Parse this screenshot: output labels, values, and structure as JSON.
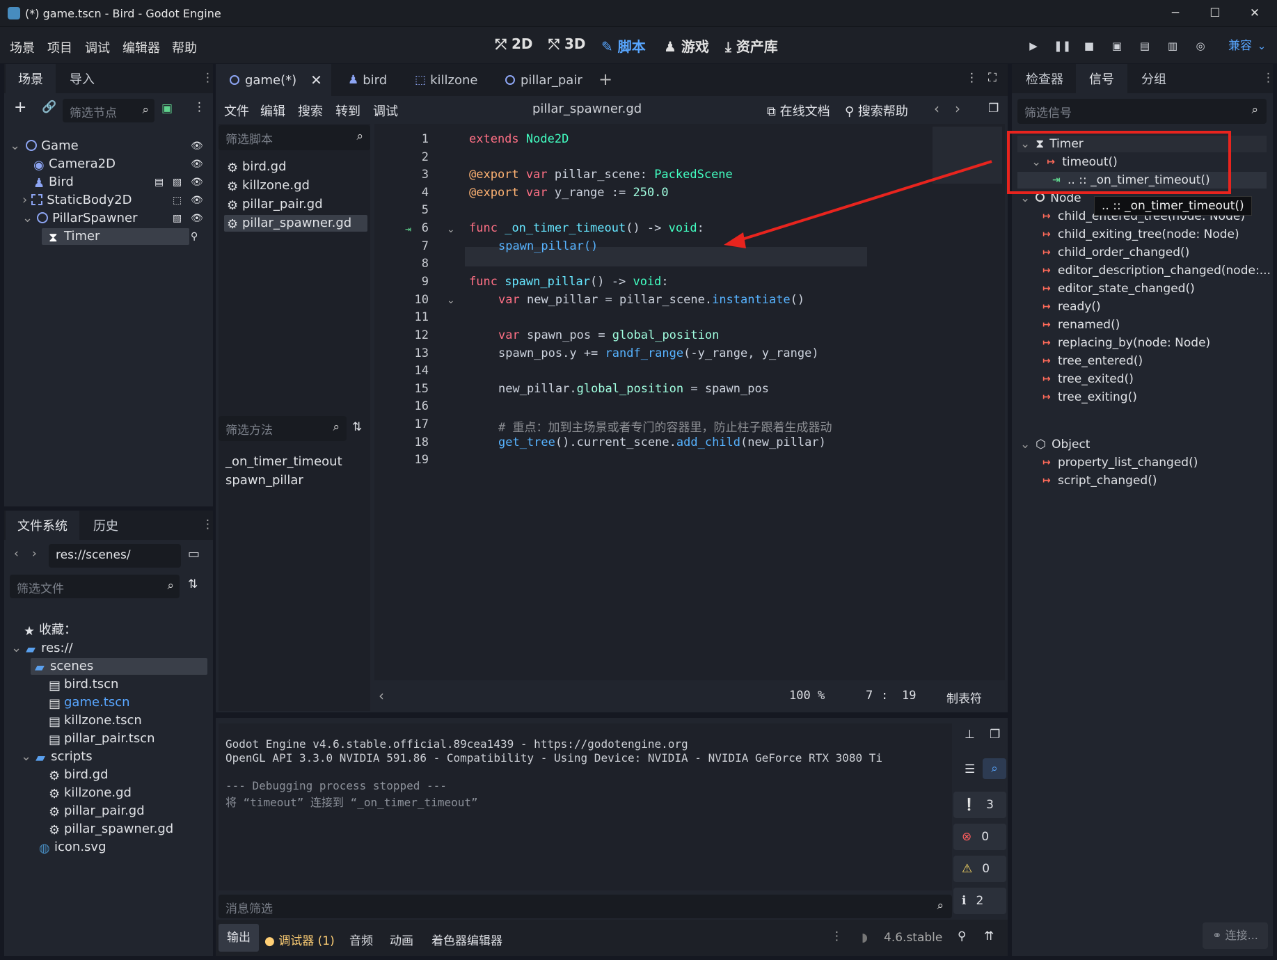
{
  "window": {
    "title": "(*) game.tscn - Bird - Godot Engine",
    "min": "─",
    "max": "☐",
    "close": "✕"
  },
  "menu": [
    "场景",
    "项目",
    "调试",
    "编辑器",
    "帮助"
  ],
  "workspaces": [
    {
      "label": "2D"
    },
    {
      "label": "3D"
    },
    {
      "label": "脚本"
    },
    {
      "label": "游戏"
    },
    {
      "label": "资产库"
    }
  ],
  "renderer": "兼容",
  "scene_dock": {
    "tabs": [
      "场景",
      "导入"
    ],
    "filter_placeholder": "筛选节点",
    "nodes": [
      {
        "name": "Game",
        "arrow": "⌄"
      },
      {
        "name": "Camera2D"
      },
      {
        "name": "Bird"
      },
      {
        "name": "StaticBody2D",
        "arrow": "›"
      },
      {
        "name": "PillarSpawner",
        "arrow": "⌄"
      },
      {
        "name": "Timer"
      }
    ]
  },
  "fs_dock": {
    "tabs": [
      "文件系统",
      "历史"
    ],
    "path": "res://scenes/",
    "filter_placeholder": "筛选文件",
    "favorites": "收藏：",
    "items": [
      {
        "label": "res://"
      },
      {
        "label": "scenes"
      },
      {
        "label": "bird.tscn"
      },
      {
        "label": "game.tscn"
      },
      {
        "label": "killzone.tscn"
      },
      {
        "label": "pillar_pair.tscn"
      },
      {
        "label": "scripts"
      },
      {
        "label": "bird.gd"
      },
      {
        "label": "killzone.gd"
      },
      {
        "label": "pillar_pair.gd"
      },
      {
        "label": "pillar_spawner.gd"
      },
      {
        "label": "icon.svg"
      }
    ]
  },
  "scene_tabs": [
    {
      "label": "game(*)",
      "close": "✕"
    },
    {
      "label": "bird"
    },
    {
      "label": "killzone"
    },
    {
      "label": "pillar_pair"
    }
  ],
  "add_tab": "+",
  "script_menu": [
    "文件",
    "编辑",
    "搜索",
    "转到",
    "调试"
  ],
  "script_name": "pillar_spawner.gd",
  "online_docs": "在线文档",
  "search_help": "搜索帮助",
  "script_filter_placeholder": "筛选脚本",
  "scripts": [
    "bird.gd",
    "killzone.gd",
    "pillar_pair.gd",
    "pillar_spawner.gd"
  ],
  "method_filter_placeholder": "筛选方法",
  "methods": [
    "_on_timer_timeout",
    "spawn_pillar"
  ],
  "code_lines": [
    "1",
    "2",
    "3",
    "4",
    "5",
    "6",
    "7",
    "8",
    "9",
    "10",
    "11",
    "12",
    "13",
    "14",
    "15",
    "16",
    "17",
    "18",
    "19"
  ],
  "code": {
    "l1a": "extends",
    "l1b": "Node2D",
    "l3a": "@export",
    "l3b": "var",
    "l3c": "pillar_scene:",
    "l3d": "PackedScene",
    "l4a": "@export",
    "l4b": "var",
    "l4c": "y_range := ",
    "l4d": "250.0",
    "l6a": "func",
    "l6b": "_on_timer_timeout",
    "l6c": "() -> ",
    "l6d": "void",
    ":": ":",
    "l7": "spawn_pillar()",
    "l9a": "func",
    "l9b": "spawn_pillar",
    "l9c": "() -> ",
    "l9d": "void",
    "l10a": "var",
    "l10b": "new_pillar = pillar_scene.",
    "l10c": "instantiate",
    "l10d": "()",
    "l12a": "var",
    "l12b": "spawn_pos = ",
    "l12c": "global_position",
    "l13a": "spawn_pos.y += ",
    "l13b": "randf_range",
    "l13c": "(-y_range, y_range)",
    "l15a": "new_pillar.",
    "l15b": "global_position",
    "l15c": " = spawn_pos",
    "l17": "# 重点：加到主场景或者专门的容器里，防止柱子跟着生成器动",
    "l18a": "get_tree",
    "l18b": "().current_scene.",
    "l18c": "add_child",
    "l18d": "(new_pillar)"
  },
  "status": {
    "zoom": "100 %",
    "line": "7",
    "colon": ":",
    "col": "19",
    "indent": "制表符"
  },
  "output": {
    "lines": [
      "Godot Engine v4.6.stable.official.89cea1439 - https://godotengine.org",
      "OpenGL API 3.3.0 NVIDIA 591.86 - Compatibility - Using Device: NVIDIA - NVIDIA GeForce RTX 3080 Ti",
      "--- Debugging process stopped ---",
      "将 “timeout” 连接到 “_on_timer_timeout”"
    ],
    "filter_placeholder": "消息筛选",
    "counts": [
      "3",
      "0",
      "0",
      "2"
    ]
  },
  "bottom_tabs": [
    "输出",
    "调试器 (1)",
    "音频",
    "动画",
    "着色器编辑器"
  ],
  "version": "4.6.stable",
  "inspector": {
    "tabs": [
      "检查器",
      "信号",
      "分组"
    ],
    "filter_placeholder": "筛选信号",
    "signals": [
      {
        "label": "Timer"
      },
      {
        "label": "timeout()"
      },
      {
        "label": ".. :: _on_timer_timeout()"
      },
      {
        "label": "Node"
      },
      {
        "label": "child_entered_tree(node: Node)"
      },
      {
        "label": "child_exiting_tree(node: Node)"
      },
      {
        "label": "child_order_changed()"
      },
      {
        "label": "editor_description_changed(node:..."
      },
      {
        "label": "editor_state_changed()"
      },
      {
        "label": "ready()"
      },
      {
        "label": "renamed()"
      },
      {
        "label": "replacing_by(node: Node)"
      },
      {
        "label": "tree_entered()"
      },
      {
        "label": "tree_exited()"
      },
      {
        "label": "tree_exiting()"
      },
      {
        "label": "Object"
      },
      {
        "label": "property_list_changed()"
      },
      {
        "label": "script_changed()"
      }
    ],
    "tooltip": ".. :: _on_timer_timeout()",
    "connect": "连接..."
  },
  "colors": {
    "accent": "#58a6ff",
    "annotation": "#e8241e"
  }
}
